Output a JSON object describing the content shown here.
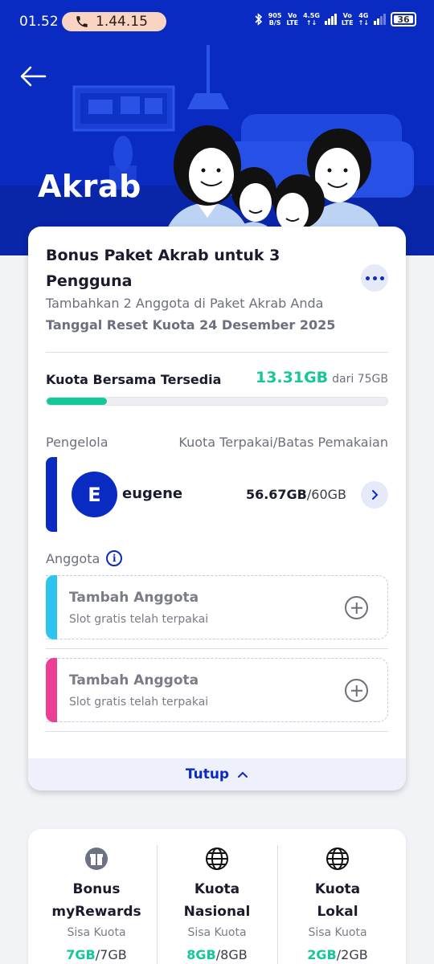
{
  "status_bar": {
    "time": "01.52",
    "call_timer": "1.44.15",
    "net_speed_top": "905",
    "net_speed_bottom": "B/S",
    "volte1_top": "Vo",
    "volte1_bottom": "LTE",
    "net1": "4.5G",
    "volte2_top": "Vo",
    "volte2_bottom": "LTE",
    "net2": "4G",
    "battery": "36"
  },
  "header": {
    "title": "Akrab",
    "back_icon": "arrow-left-icon"
  },
  "package": {
    "title": "Bonus Paket Akrab untuk 3 Pengguna",
    "subtitle": "Tambahkan 2 Anggota di Paket Akrab Anda",
    "reset_date": "Tanggal Reset Kuota 24 Desember 2025",
    "more_icon": "more-horizontal-icon"
  },
  "quota": {
    "label": "Kuota Bersama Tersedia",
    "available": "13.31GB",
    "of_label": "dari 75GB",
    "available_fraction": 0.177
  },
  "manager": {
    "section_label": "Pengelola",
    "usage_header": "Kuota Terpakai/Batas Pemakaian",
    "initial": "E",
    "name": "eugene",
    "used": "56.67GB",
    "limit": "/60GB"
  },
  "members": {
    "section_label": "Anggota",
    "slots": [
      {
        "title": "Tambah Anggota",
        "subtitle": "Slot gratis telah terpakai",
        "color": "#2ec4f0"
      },
      {
        "title": "Tambah Anggota",
        "subtitle": "Slot gratis telah terpakai",
        "color": "#ec3f94"
      }
    ]
  },
  "collapse": {
    "label": "Tutup",
    "icon": "chevron-up-icon"
  },
  "benefits": [
    {
      "title_line1": "Bonus",
      "title_line2": "myRewards",
      "sisa_label": "Sisa Kuota",
      "remaining": "7GB",
      "total": "/7GB",
      "icon": "gift-icon"
    },
    {
      "title_line1": "Kuota",
      "title_line2": "Nasional",
      "sisa_label": "Sisa Kuota",
      "remaining": "8GB",
      "total": "/8GB",
      "icon": "globe-icon"
    },
    {
      "title_line1": "Kuota",
      "title_line2": "Lokal",
      "sisa_label": "Sisa Kuota",
      "remaining": "2GB",
      "total": "/2GB",
      "icon": "globe-icon"
    }
  ],
  "colors": {
    "brand_blue": "#0a2bc2",
    "accent_green": "#16c79a"
  }
}
